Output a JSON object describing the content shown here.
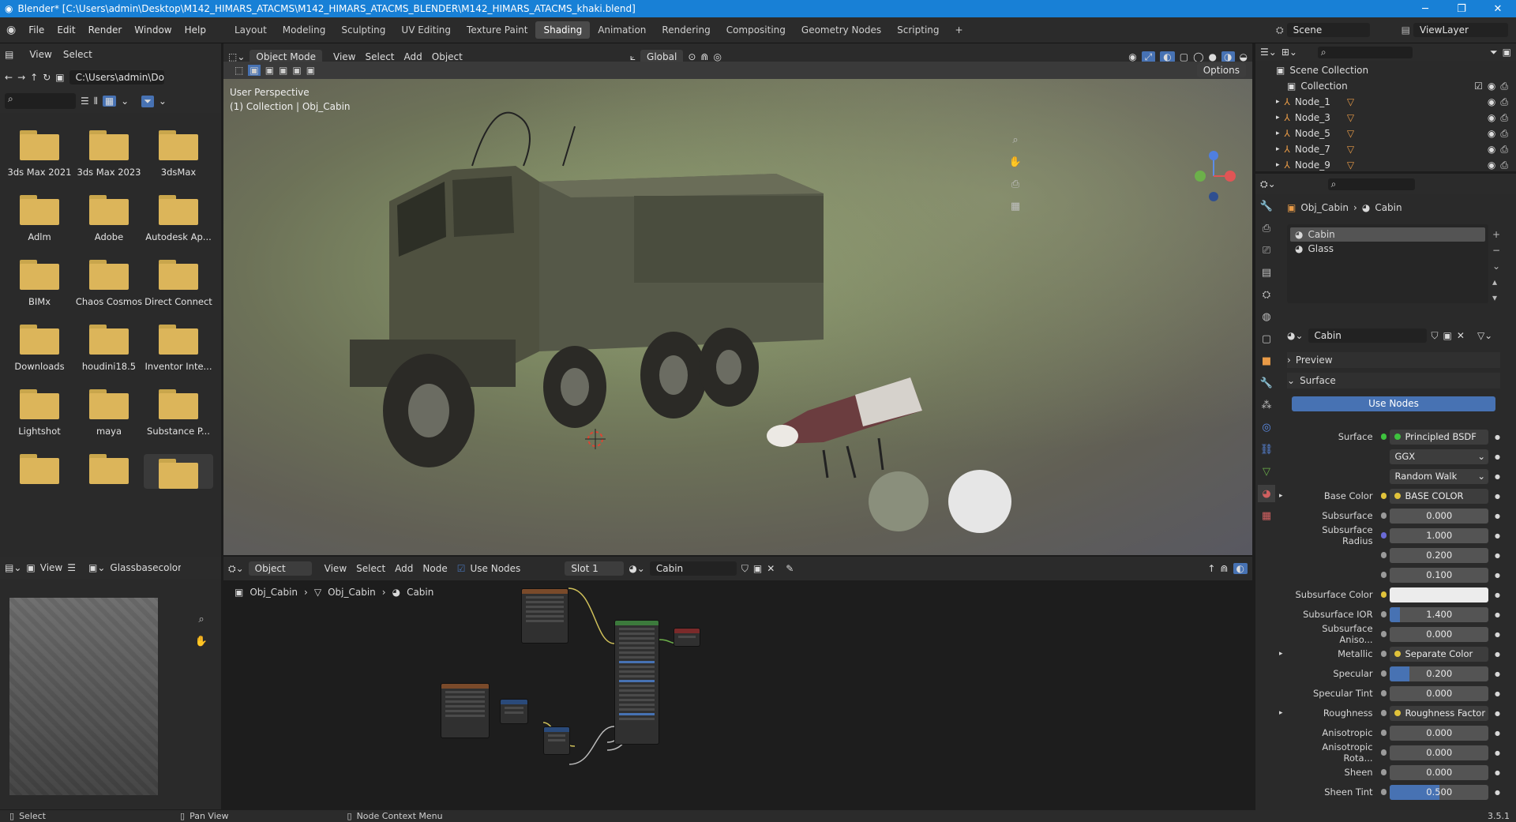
{
  "window": {
    "title": "Blender* [C:\\Users\\admin\\Desktop\\M142_HIMARS_ATACMS\\M142_HIMARS_ATACMS_BLENDER\\M142_HIMARS_ATACMS_khaki.blend]",
    "minimize": "─",
    "maximize": "❐",
    "close": "✕"
  },
  "menu": [
    "File",
    "Edit",
    "Render",
    "Window",
    "Help"
  ],
  "workspaces": [
    "Layout",
    "Modeling",
    "Sculpting",
    "UV Editing",
    "Texture Paint",
    "Shading",
    "Animation",
    "Rendering",
    "Compositing",
    "Geometry Nodes",
    "Scripting",
    "+"
  ],
  "active_workspace": "Shading",
  "scene": {
    "name": "Scene",
    "view_layer": "ViewLayer"
  },
  "file_browser": {
    "menus": [
      "View",
      "Select"
    ],
    "path": "C:\\Users\\admin\\Do...",
    "items": [
      "3ds Max 2021",
      "3ds Max 2023",
      "3dsMax",
      "Adlm",
      "Adobe",
      "Autodesk Ap...",
      "BIMx",
      "Chaos Cosmos",
      "Direct Connect",
      "Downloads",
      "houdini18.5",
      "Inventor Inte...",
      "Lightshot",
      "maya",
      "Substance P...",
      "",
      "",
      ""
    ]
  },
  "viewport": {
    "mode": "Object Mode",
    "menus": [
      "View",
      "Select",
      "Add",
      "Object"
    ],
    "orientation": "Global",
    "options": "Options",
    "info_line1": "User Perspective",
    "info_line2": "(1) Collection | Obj_Cabin"
  },
  "outliner": {
    "root": "Scene Collection",
    "collection": "Collection",
    "nodes": [
      "Node_1",
      "Node_3",
      "Node_5",
      "Node_7",
      "Node_9"
    ]
  },
  "properties": {
    "breadcrumb_obj": "Obj_Cabin",
    "breadcrumb_mat": "Cabin",
    "slots": [
      "Cabin",
      "Glass"
    ],
    "material": "Cabin",
    "preview": "Preview",
    "surface": "Surface",
    "use_nodes": "Use Nodes",
    "rows": [
      {
        "label": "Surface",
        "kind": "text",
        "value": "Principled BSDF",
        "dot": "#3ec23e"
      },
      {
        "label": "",
        "kind": "dropdown",
        "value": "GGX"
      },
      {
        "label": "",
        "kind": "dropdown",
        "value": "Random Walk"
      },
      {
        "label": "Base Color",
        "kind": "text",
        "value": "BASE COLOR",
        "dot": "#e0c23a",
        "expand": true
      },
      {
        "label": "Subsurface",
        "kind": "num",
        "value": "0.000",
        "fill": 0
      },
      {
        "label": "Subsurface Radius",
        "kind": "num",
        "value": "1.000",
        "fill": 0,
        "dot": "#6a6ad6"
      },
      {
        "label": "",
        "kind": "num",
        "value": "0.200",
        "fill": 0
      },
      {
        "label": "",
        "kind": "num",
        "value": "0.100",
        "fill": 0
      },
      {
        "label": "Subsurface Color",
        "kind": "color",
        "value": "",
        "dot": "#e0c23a"
      },
      {
        "label": "Subsurface IOR",
        "kind": "num",
        "value": "1.400",
        "fill": 0.1
      },
      {
        "label": "Subsurface Aniso...",
        "kind": "num",
        "value": "0.000",
        "fill": 0
      },
      {
        "label": "Metallic",
        "kind": "text",
        "value": "Separate Color",
        "expand": true
      },
      {
        "label": "Specular",
        "kind": "num",
        "value": "0.200",
        "fill": 0.2
      },
      {
        "label": "Specular Tint",
        "kind": "num",
        "value": "0.000",
        "fill": 0
      },
      {
        "label": "Roughness",
        "kind": "text",
        "value": "Roughness Factor",
        "expand": true
      },
      {
        "label": "Anisotropic",
        "kind": "num",
        "value": "0.000",
        "fill": 0
      },
      {
        "label": "Anisotropic Rota...",
        "kind": "num",
        "value": "0.000",
        "fill": 0
      },
      {
        "label": "Sheen",
        "kind": "num",
        "value": "0.000",
        "fill": 0
      },
      {
        "label": "Sheen Tint",
        "kind": "num",
        "value": "0.500",
        "fill": 0.5
      }
    ]
  },
  "image_editor": {
    "view": "View",
    "image": "Glassbasecolorte"
  },
  "node_editor": {
    "object": "Object",
    "menus": [
      "View",
      "Select",
      "Add",
      "Node"
    ],
    "use_nodes": "Use Nodes",
    "slot": "Slot 1",
    "material": "Cabin",
    "breadcrumb": [
      "Obj_Cabin",
      "Obj_Cabin",
      "Cabin"
    ]
  },
  "statusbar": {
    "select": "Select",
    "pan": "Pan View",
    "context": "Node Context Menu",
    "version": "3.5.1"
  }
}
